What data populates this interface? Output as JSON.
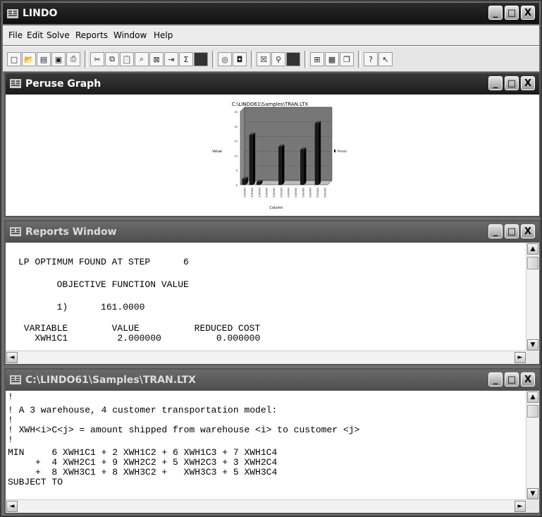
{
  "app": {
    "title": "LINDO"
  },
  "menu": [
    "File",
    "Edit",
    "Solve",
    "Reports",
    "Window",
    "Help"
  ],
  "window_buttons": {
    "minimize": "_",
    "maximize": "□",
    "close": "X"
  },
  "graph_window": {
    "title": "Peruse Graph",
    "chart_data": {
      "type": "bar",
      "title": "C:\\LINDO61\\Samples\\TRAN.LTX",
      "xlabel": "Column",
      "ylabel": "Value",
      "legend": "Primal",
      "legend_position": "right",
      "ylim": [
        0,
        25
      ],
      "yticks": [
        "0",
        "5",
        "10",
        "15",
        "20",
        "25"
      ],
      "categories": [
        "XWH1C1",
        "XWH1C2",
        "XWH1C3",
        "XWH1C4",
        "XWH2C1",
        "XWH2C2",
        "XWH2C3",
        "XWH2C4",
        "XWH3C1",
        "XWH3C2",
        "XWH3C3",
        "XWH3C4"
      ],
      "values": [
        2,
        17,
        1,
        0,
        0,
        13,
        0,
        0,
        12,
        0,
        21,
        0
      ],
      "bar_color": "#1a1a1a"
    }
  },
  "reports_window": {
    "title": "Reports Window",
    "lines": [
      "LP OPTIMUM FOUND AT STEP      6",
      "       OBJECTIVE FUNCTION VALUE",
      "       1)      161.0000",
      " VARIABLE        VALUE          REDUCED COST",
      "   XWH1C1         2.000000          0.000000"
    ]
  },
  "model_window": {
    "title": "C:\\LINDO61\\Samples\\TRAN.LTX",
    "lines": [
      "!",
      "! A 3 warehouse, 4 customer transportation model:",
      "!",
      "! XWH<i>C<j> = amount shipped from warehouse <i> to customer <j>",
      "!",
      "MIN     6 XWH1C1 + 2 XWH1C2 + 6 XWH1C3 + 7 XWH1C4",
      "     +  4 XWH2C1 + 9 XWH2C2 + 5 XWH2C3 + 3 XWH2C4",
      "     +  8 XWH3C1 + 8 XWH3C2 +   XWH3C3 + 5 XWH3C4",
      "SUBJECT TO"
    ]
  },
  "scroll": {
    "up": "▲",
    "down": "▼",
    "left": "◄",
    "right": "►"
  },
  "toolbar_icons": [
    "new-icon",
    "open-icon",
    "save-icon",
    "save-as-icon",
    "print-icon",
    "cut-icon",
    "copy-icon",
    "paste-icon",
    "find-icon",
    "clear-icon",
    "go-to-line-icon",
    "sum-icon",
    "stop-icon",
    "solve-icon",
    "compile-icon",
    "options-icon",
    "report-icon",
    "picture-icon",
    "window-icon",
    "tile-icon",
    "cascade-icon",
    "help-icon",
    "context-help-icon"
  ]
}
